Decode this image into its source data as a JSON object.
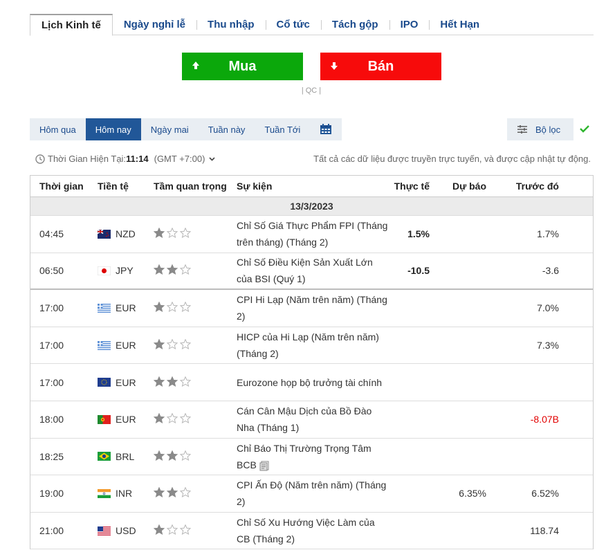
{
  "top_tabs": [
    {
      "label": "Lịch Kinh tế",
      "active": true
    },
    {
      "label": "Ngày nghỉ lễ"
    },
    {
      "label": "Thu nhập"
    },
    {
      "label": "Cổ tức"
    },
    {
      "label": "Tách gộp"
    },
    {
      "label": "IPO"
    },
    {
      "label": "Hết Hạn"
    }
  ],
  "trade": {
    "buy_label": "Mua",
    "sell_label": "Bán",
    "buy_color": "#0ba80b",
    "sell_color": "#f70b0b",
    "ad_label": "| QC |"
  },
  "day_tabs": [
    {
      "label": "Hôm qua"
    },
    {
      "label": "Hôm nay",
      "active": true
    },
    {
      "label": "Ngày mai"
    },
    {
      "label": "Tuần này"
    },
    {
      "label": "Tuần Tới"
    }
  ],
  "filter_label": "Bộ lọc",
  "timebar": {
    "prefix": "Thời Gian Hiện Tại:",
    "time": "11:14",
    "timezone": "(GMT +7:00)",
    "live_note": "Tất cả các dữ liệu được truyền trực tuyến, và được cập nhật tự động."
  },
  "table": {
    "headers": {
      "time": "Thời gian",
      "currency": "Tiền tệ",
      "importance": "Tầm quan trọng",
      "event": "Sự kiện",
      "actual": "Thực tế",
      "forecast": "Dự báo",
      "previous": "Trước đó"
    },
    "date": "13/3/2023",
    "rows": [
      {
        "time": "04:45",
        "currency": "NZD",
        "flag": "nz",
        "stars": 1,
        "event": "Chỉ Số Giá Thực Phẩm FPI (Tháng trên tháng) (Tháng 2)",
        "actual": "1.5%",
        "forecast": "",
        "previous": "1.7%"
      },
      {
        "time": "06:50",
        "currency": "JPY",
        "flag": "jp",
        "stars": 2,
        "event": "Chỉ Số Điều Kiện Sản Xuất Lớn của BSI (Quý 1)",
        "actual": "-10.5",
        "forecast": "",
        "previous": "-3.6"
      },
      {
        "time": "17:00",
        "currency": "EUR",
        "flag": "gr",
        "stars": 1,
        "event": "CPI Hi Lạp (Năm trên năm) (Tháng 2)",
        "actual": "",
        "forecast": "",
        "previous": "7.0%"
      },
      {
        "time": "17:00",
        "currency": "EUR",
        "flag": "gr",
        "stars": 1,
        "event": "HICP của Hi Lạp (Năm trên năm) (Tháng 2)",
        "actual": "",
        "forecast": "",
        "previous": "7.3%"
      },
      {
        "time": "17:00",
        "currency": "EUR",
        "flag": "eu",
        "stars": 2,
        "event": "Eurozone họp bộ trưởng tài chính",
        "actual": "",
        "forecast": "",
        "previous": ""
      },
      {
        "time": "18:00",
        "currency": "EUR",
        "flag": "pt",
        "stars": 1,
        "event": "Cán Cân Mậu Dịch của Bồ Đào Nha (Tháng 1)",
        "actual": "",
        "forecast": "",
        "previous": "-8.07B",
        "previous_negative": true
      },
      {
        "time": "18:25",
        "currency": "BRL",
        "flag": "br",
        "stars": 2,
        "event": "Chỉ Báo Thị Trường Trọng Tâm BCB",
        "actual": "",
        "forecast": "",
        "previous": "",
        "doc_icon": true
      },
      {
        "time": "19:00",
        "currency": "INR",
        "flag": "in",
        "stars": 2,
        "event": "CPI Ấn Độ (Năm trên năm) (Tháng 2)",
        "actual": "",
        "forecast": "6.35%",
        "previous": "6.52%"
      },
      {
        "time": "21:00",
        "currency": "USD",
        "flag": "us",
        "stars": 1,
        "event": "Chỉ Số Xu Hướng Việc Làm của CB (Tháng 2)",
        "actual": "",
        "forecast": "",
        "previous": "118.74"
      }
    ]
  }
}
